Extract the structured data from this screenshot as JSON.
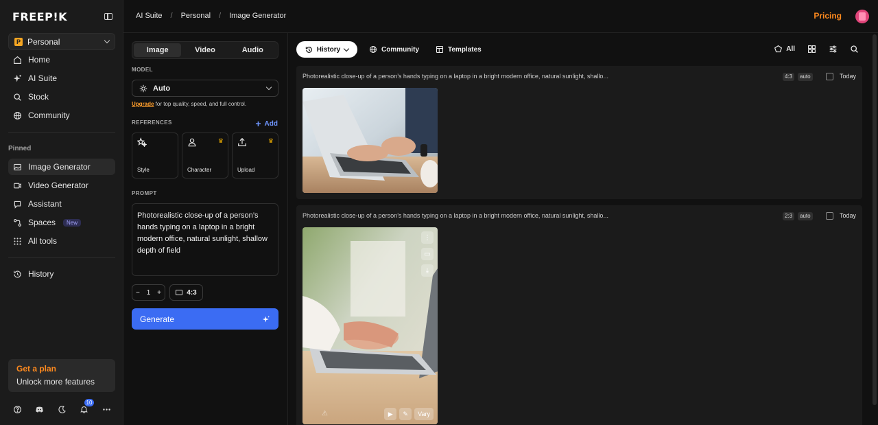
{
  "sidebar": {
    "logo": "FREEP!K",
    "workspace": {
      "badge": "P",
      "label": "Personal"
    },
    "nav": [
      {
        "label": "Home",
        "icon": "home-icon"
      },
      {
        "label": "AI Suite",
        "icon": "sparkle-icon"
      },
      {
        "label": "Stock",
        "icon": "search-icon"
      },
      {
        "label": "Community",
        "icon": "globe-icon"
      }
    ],
    "pinned_label": "Pinned",
    "pinned": [
      {
        "label": "Image Generator",
        "icon": "image-icon",
        "active": true
      },
      {
        "label": "Video Generator",
        "icon": "video-icon"
      },
      {
        "label": "Assistant",
        "icon": "assistant-icon"
      },
      {
        "label": "Spaces",
        "icon": "spaces-icon",
        "badge": "New"
      },
      {
        "label": "All tools",
        "icon": "grid-icon"
      }
    ],
    "history_label": "History",
    "plan": {
      "title": "Get a plan",
      "subtitle": "Unlock more features"
    },
    "notifications_count": "10"
  },
  "topbar": {
    "breadcrumbs": [
      "AI Suite",
      "Personal",
      "Image Generator"
    ],
    "pricing": "Pricing"
  },
  "panel": {
    "tabs": [
      "Image",
      "Video",
      "Audio"
    ],
    "model_label": "MODEL",
    "model_value": "Auto",
    "upgrade_link": "Upgrade",
    "upgrade_text": " for top quality, speed, and full control.",
    "references_label": "REFERENCES",
    "add_label": "Add",
    "references": [
      {
        "label": "Style",
        "icon": "style-icon",
        "premium": false
      },
      {
        "label": "Character",
        "icon": "character-icon",
        "premium": true
      },
      {
        "label": "Upload",
        "icon": "upload-icon",
        "premium": true
      }
    ],
    "prompt_label": "PROMPT",
    "prompt_text": "Photorealistic close-up of a person’s hands typing on a laptop in a bright modern office, natural sunlight, shallow depth of field",
    "quantity": "1",
    "ratio": "4:3",
    "generate_label": "Generate"
  },
  "main": {
    "history_pill": "History",
    "community": "Community",
    "templates": "Templates",
    "filter_all": "All",
    "results": [
      {
        "prompt": "Photorealistic close-up of a person’s hands typing on a laptop in a bright modern office, natural sunlight, shallo...",
        "ratio": "4:3",
        "mode": "auto",
        "date": "Today"
      },
      {
        "prompt": "Photorealistic close-up of a person’s hands typing on a laptop in a bright modern office, natural sunlight, shallo...",
        "ratio": "2:3",
        "mode": "auto",
        "date": "Today",
        "vary_label": "Vary"
      }
    ]
  },
  "colors": {
    "accent_blue": "#3b6cf3",
    "accent_orange": "#ff8a1e",
    "background": "#111111",
    "sidebar": "#1b1b1b"
  }
}
